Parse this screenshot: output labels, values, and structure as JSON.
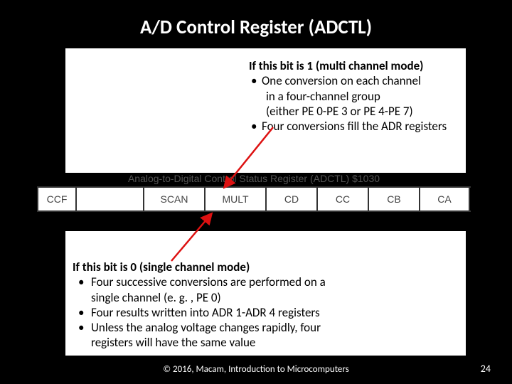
{
  "title": "A/D Control Register (ADCTL)",
  "multi": {
    "heading": "If this bit is 1 (multi channel mode)",
    "b1": "One conversion on each channel",
    "b1c1": "in a four-channel group",
    "b1c2": "(either PE 0-PE 3 or PE 4-PE 7)",
    "b2": "Four conversions fill the ADR registers"
  },
  "single": {
    "heading": "If this bit is 0 (single channel mode)",
    "b1": "Four successive conversions are performed on a",
    "b1c": "single channel (e. g. , PE 0)",
    "b2": "Four results written into ADR 1-ADR 4 registers",
    "b3": "Unless the analog voltage changes rapidly, four",
    "b3c": "registers will have the same value"
  },
  "register": {
    "caption": "Analog-to-Digital Control Status Register (ADCTL)  $1030",
    "cells": [
      "CCF",
      "",
      "SCAN",
      "MULT",
      "CD",
      "CC",
      "CB",
      "CA"
    ]
  },
  "footer": {
    "cite": "© 2016, Macam, Introduction to Microcomputers",
    "page": "24"
  }
}
